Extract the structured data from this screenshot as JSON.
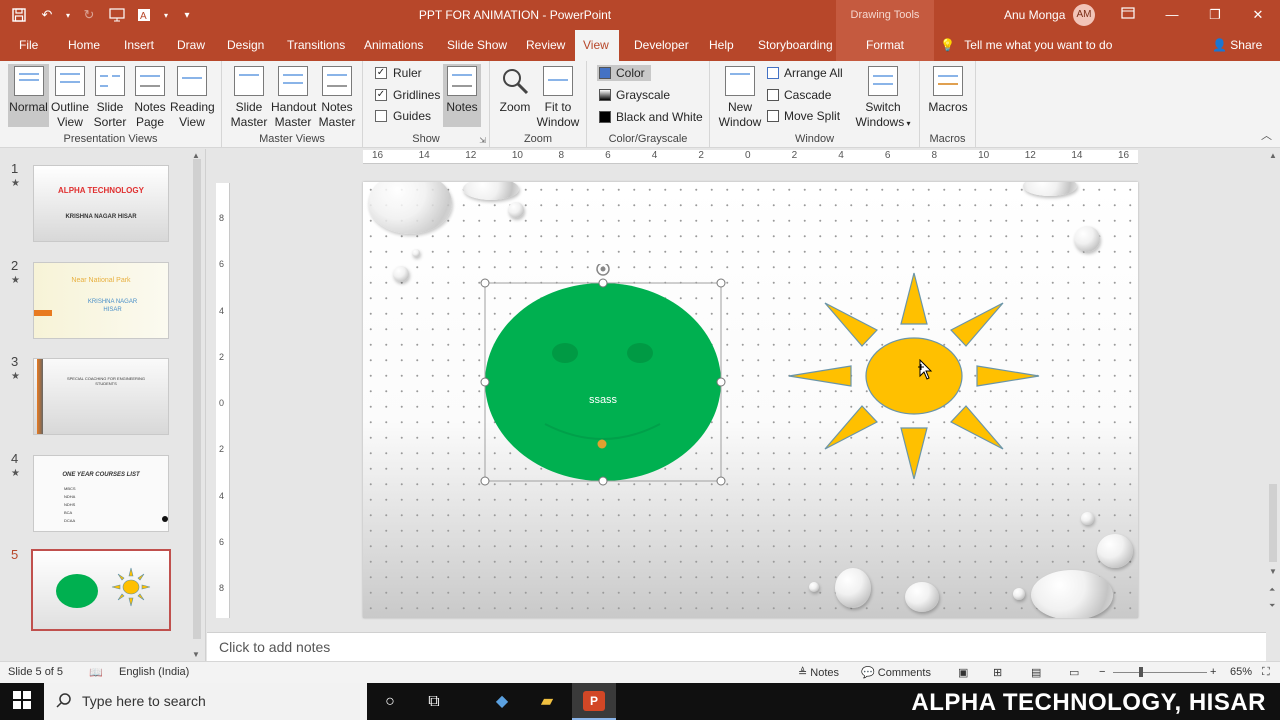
{
  "window": {
    "title": "PPT FOR ANIMATION  -  PowerPoint",
    "context_tab_group": "Drawing Tools",
    "user_name": "Anu Monga",
    "user_initials": "AM"
  },
  "tabs": [
    "File",
    "Home",
    "Insert",
    "Draw",
    "Design",
    "Transitions",
    "Animations",
    "Slide Show",
    "Review",
    "View",
    "Developer",
    "Help",
    "Storyboarding",
    "Format"
  ],
  "active_tab": "View",
  "tell_me": "Tell me what you want to do",
  "share": "Share",
  "ribbon": {
    "presentation_views": {
      "label": "Presentation Views",
      "normal": "Normal",
      "outline": "Outline View",
      "sorter": "Slide Sorter",
      "notes_page": "Notes Page",
      "reading": "Reading View"
    },
    "master_views": {
      "label": "Master Views",
      "slide_master": "Slide Master",
      "handout_master": "Handout Master",
      "notes_master": "Notes Master"
    },
    "show": {
      "label": "Show",
      "ruler": "Ruler",
      "gridlines": "Gridlines",
      "guides": "Guides",
      "notes": "Notes"
    },
    "zoom": {
      "label": "Zoom",
      "zoom": "Zoom",
      "fit": "Fit to Window"
    },
    "color": {
      "label": "Color/Grayscale",
      "color": "Color",
      "grayscale": "Grayscale",
      "bw": "Black and White"
    },
    "window": {
      "label": "Window",
      "new_window": "New Window",
      "arrange_all": "Arrange All",
      "cascade": "Cascade",
      "move_split": "Move Split",
      "switch": "Switch Windows"
    },
    "macros": {
      "label": "Macros",
      "macros": "Macros"
    }
  },
  "slides": [
    {
      "num": "1",
      "title": "ALPHA TECHNOLOGY",
      "subtitle": "KRISHNA NAGAR HISAR"
    },
    {
      "num": "2",
      "title": "Near National Park",
      "subtitle": "KRISHNA NAGAR HISAR"
    },
    {
      "num": "3",
      "title": "SPECIAL COACHING FOR ENGINEERING STUDENTS"
    },
    {
      "num": "4",
      "title": "ONE YEAR COURSES LIST",
      "items": [
        "MBCS",
        "NDHA",
        "NDHS",
        "BCA",
        "DCAA"
      ]
    },
    {
      "num": "5"
    }
  ],
  "slide": {
    "face_text": "ssass"
  },
  "ruler": {
    "h_ticks": [
      "16",
      "14",
      "12",
      "10",
      "8",
      "6",
      "4",
      "2",
      "0",
      "2",
      "4",
      "6",
      "8",
      "10",
      "12",
      "14",
      "16"
    ],
    "v_ticks": [
      "8",
      "6",
      "4",
      "2",
      "0",
      "2",
      "4",
      "6",
      "8"
    ]
  },
  "notes_placeholder": "Click to add notes",
  "status": {
    "slide_of": "Slide 5 of 5",
    "language": "English (India)",
    "notes": "Notes",
    "comments": "Comments",
    "zoom": "65%"
  },
  "taskbar": {
    "search": "Type here to search",
    "brand": "ALPHA TECHNOLOGY, HISAR"
  },
  "colors": {
    "accent": "#b7472a",
    "face_green": "#00b050",
    "sun_yellow": "#ffc000"
  }
}
